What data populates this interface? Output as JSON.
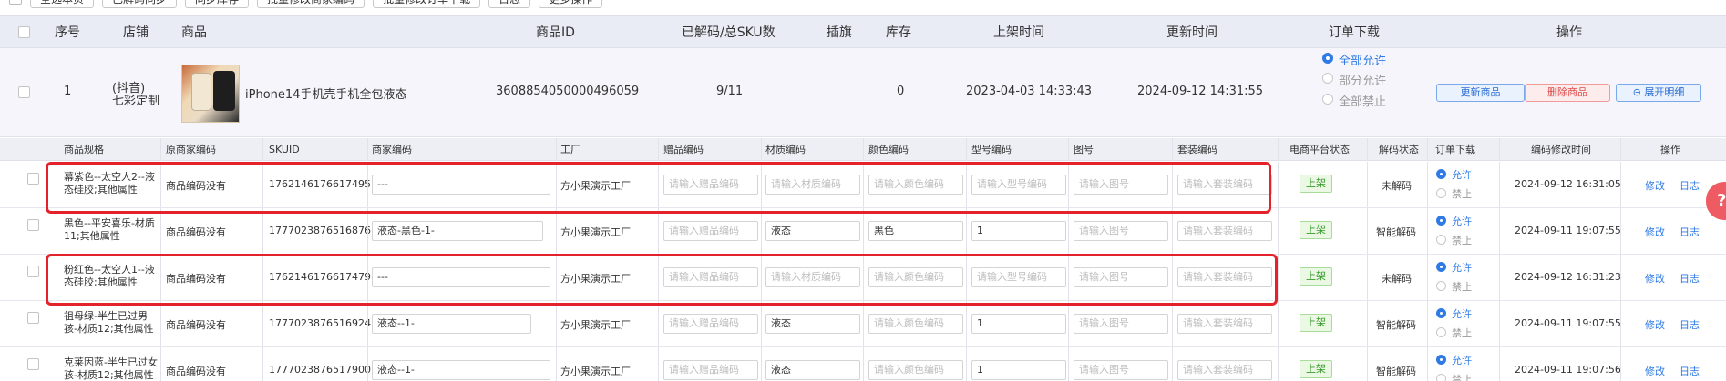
{
  "toolbar": {
    "buttons": [
      "全选本页",
      "已解码同步",
      "同步库存",
      "批量修改商家编码",
      "批量修改订单下载",
      "日志",
      "更多操作"
    ]
  },
  "main_header": {
    "index": "序号",
    "shop": "店铺",
    "product": "商品",
    "product_id": "商品ID",
    "decoded": "已解码/总SKU数",
    "flag": "插旗",
    "stock": "库存",
    "listed_time": "上架时间",
    "updated_time": "更新时间",
    "order_download": "订单下载",
    "actions": "操作"
  },
  "product": {
    "index": "1",
    "shop_line1": "(抖音)",
    "shop_line2": "七彩定制",
    "title": "iPhone14手机壳手机全包液态",
    "product_id": "3608854050000496059",
    "decoded": "9/11",
    "stock": "0",
    "listed_time": "2023-04-03 14:33:43",
    "updated_time": "2024-09-12 14:31:55",
    "order_options": [
      "全部允许",
      "部分允许",
      "全部禁止"
    ],
    "buttons": {
      "update": "更新商品",
      "delete": "删除商品",
      "expand": "展开明细"
    }
  },
  "sku_header": {
    "spec": "商品规格",
    "orig_code": "原商家编码",
    "skuid": "SKUID",
    "merchant_code": "商家编码",
    "factory": "工厂",
    "gift_code": "赠品编码",
    "material_code": "材质编码",
    "color_code": "颜色编码",
    "model_code": "型号编码",
    "figure_no": "图号",
    "set_code": "套装编码",
    "platform_status": "电商平台状态",
    "decode_status": "解码状态",
    "order_download": "订单下载",
    "code_modified_time": "编码修改时间",
    "actions": "操作"
  },
  "placeholders": {
    "gift": "请输入赠品编码",
    "material": "请输入材质编码",
    "color": "请输入颜色编码",
    "model": "请输入型号编码",
    "figure": "请输入图号",
    "set": "请输入套装编码"
  },
  "radio_labels": {
    "allow": "允许",
    "deny": "禁止"
  },
  "row_actions": {
    "edit": "修改",
    "log": "日志"
  },
  "sku_rows": [
    {
      "spec": "幕紫色--太空人2--液态硅胶;其他属性",
      "orig": "商品编码没有",
      "skuid": "1762146176617495",
      "merchant": "---",
      "factory": "方小果演示工厂",
      "material": "",
      "color": "",
      "model": "",
      "status": "上架",
      "decode": "未解码",
      "modified": "2024-09-12 16:31:05"
    },
    {
      "spec": "黑色--平安喜乐-材质11;其他属性",
      "orig": "商品编码没有",
      "skuid": "1777023876516876",
      "merchant": "液态-黑色-1-",
      "factory": "方小果演示工厂",
      "material": "液态",
      "color": "黑色",
      "model": "1",
      "status": "上架",
      "decode": "智能解码",
      "modified": "2024-09-11 19:07:55"
    },
    {
      "spec": "粉红色--太空人1--液态硅胶;其他属性",
      "orig": "商品编码没有",
      "skuid": "1762146176617479",
      "merchant": "---",
      "factory": "方小果演示工厂",
      "material": "",
      "color": "",
      "model": "",
      "status": "上架",
      "decode": "未解码",
      "modified": "2024-09-12 16:31:23"
    },
    {
      "spec": "祖母绿-半生已过男孩-材质12;其他属性",
      "orig": "商品编码没有",
      "skuid": "1777023876516924",
      "merchant": "液态--1-",
      "factory": "方小果演示工厂",
      "material": "液态",
      "color": "",
      "model": "1",
      "status": "上架",
      "decode": "智能解码",
      "modified": "2024-09-11 19:07:55"
    },
    {
      "spec": "克莱因蓝-半生已过女孩-材质12;其他属性",
      "orig": "商品编码没有",
      "skuid": "1777023876517900",
      "merchant": "液态--1-",
      "factory": "方小果演示工厂",
      "material": "液态",
      "color": "",
      "model": "1",
      "status": "上架",
      "decode": "智能解码",
      "modified": "2024-09-11 19:07:56"
    }
  ],
  "side_button": "?",
  "colors": {
    "accent": "#2f7be5",
    "highlight": "#e4222b",
    "header_bg": "#e9ebf5",
    "row_bg": "#f5f5fb"
  }
}
